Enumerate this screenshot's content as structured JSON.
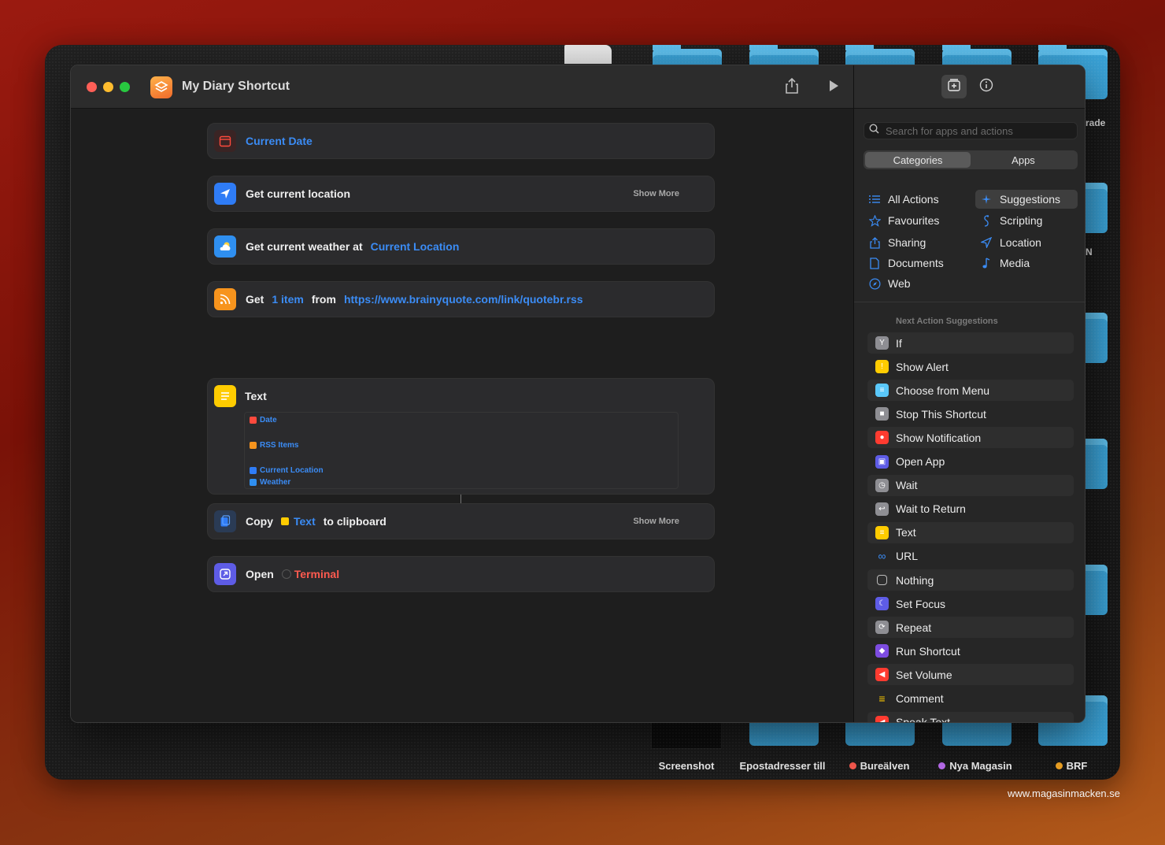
{
  "window": {
    "title": "My Diary Shortcut"
  },
  "editor": {
    "actions": [
      {
        "id": "current-date",
        "parts": [
          {
            "t": "token",
            "v": "Current Date"
          }
        ]
      },
      {
        "id": "get-location",
        "parts": [
          {
            "t": "text",
            "v": "Get current location"
          }
        ],
        "show_more": "Show More"
      },
      {
        "id": "get-weather",
        "parts": [
          {
            "t": "text",
            "v": "Get current weather at"
          },
          {
            "t": "token",
            "v": "Current Location"
          }
        ]
      },
      {
        "id": "get-rss",
        "parts": [
          {
            "t": "text",
            "v": "Get"
          },
          {
            "t": "token",
            "v": "1 item"
          },
          {
            "t": "text",
            "v": "from"
          },
          {
            "t": "token",
            "v": "https://www.brainyquote.com/link/quotebr.rss"
          }
        ]
      },
      {
        "id": "copy",
        "parts": [
          {
            "t": "text",
            "v": "Copy"
          },
          {
            "t": "token",
            "v": "Text"
          },
          {
            "t": "text",
            "v": "to clipboard"
          }
        ],
        "show_more": "Show More"
      },
      {
        "id": "open",
        "parts": [
          {
            "t": "text",
            "v": "Open"
          },
          {
            "t": "token",
            "v": "Terminal"
          }
        ]
      }
    ],
    "text_action": {
      "label": "Text",
      "variables": [
        "Date",
        "RSS Items",
        "Current Location",
        "Weather"
      ]
    }
  },
  "sidebar": {
    "search_placeholder": "Search for apps and actions",
    "segments": [
      "Categories",
      "Apps"
    ],
    "categories_left": [
      "All Actions",
      "Favourites",
      "Sharing",
      "Documents",
      "Web"
    ],
    "categories_right": [
      "Suggestions",
      "Scripting",
      "Location",
      "Media"
    ],
    "next_action_label": "Next Action Suggestions",
    "suggestions": [
      {
        "label": "If",
        "color": "#8e8e93",
        "icon": "branch-icon"
      },
      {
        "label": "Show Alert",
        "color": "#ffcc00",
        "icon": "alert-icon"
      },
      {
        "label": "Choose from Menu",
        "color": "#5ac8fa",
        "icon": "menu-icon"
      },
      {
        "label": "Stop This Shortcut",
        "color": "#8e8e93",
        "icon": "stop-icon"
      },
      {
        "label": "Show Notification",
        "color": "#ff3b30",
        "icon": "bell-icon"
      },
      {
        "label": "Open App",
        "color": "#5e5ce6",
        "icon": "app-icon"
      },
      {
        "label": "Wait",
        "color": "#8e8e93",
        "icon": "clock-icon"
      },
      {
        "label": "Wait to Return",
        "color": "#8e8e93",
        "icon": "return-icon"
      },
      {
        "label": "Text",
        "color": "#ffcc00",
        "icon": "text-icon"
      },
      {
        "label": "URL",
        "color": "#3b8cf5",
        "icon": "link-icon"
      },
      {
        "label": "Nothing",
        "color": "#3a3a3a",
        "icon": "empty-icon"
      },
      {
        "label": "Set Focus",
        "color": "#5e5ce6",
        "icon": "moon-icon"
      },
      {
        "label": "Repeat",
        "color": "#8e8e93",
        "icon": "repeat-icon"
      },
      {
        "label": "Run Shortcut",
        "color": "#7d4ce0",
        "icon": "shortcuts-icon"
      },
      {
        "label": "Set Volume",
        "color": "#ff3b30",
        "icon": "speaker-icon"
      },
      {
        "label": "Comment",
        "color": "#ffcc00",
        "icon": "comment-icon"
      },
      {
        "label": "Speak Text",
        "color": "#ff3b30",
        "icon": "speak-icon"
      }
    ]
  },
  "desktop": {
    "labels": [
      {
        "text": "Screenshot",
        "dot": ""
      },
      {
        "text": "Epostadresser till",
        "dot": ""
      },
      {
        "text": "Bureälven",
        "dot": "#ff5a4f"
      },
      {
        "text": "Nya Magasin",
        "dot": "#bf6ef5"
      },
      {
        "text": "BRF",
        "dot": "#f5a623"
      }
    ],
    "side_fragments": [
      "rade",
      "N"
    ]
  },
  "watermark": "www.magasinmacken.se"
}
